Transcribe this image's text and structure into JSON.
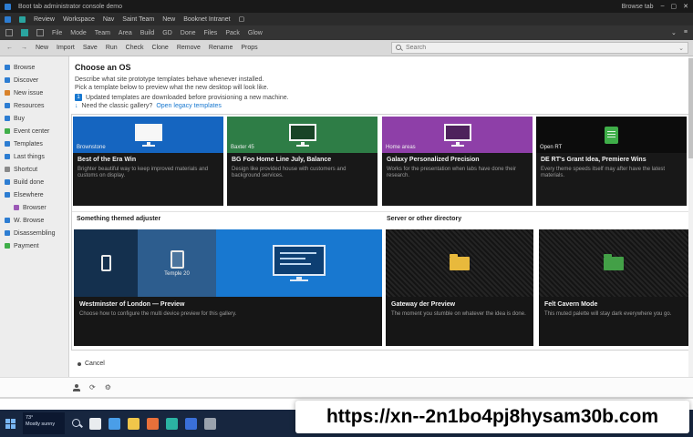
{
  "window": {
    "title": "Boot tab administrator console demo",
    "title_right": "Browse tab",
    "min": "–",
    "max": "▢",
    "close": "✕"
  },
  "glyphs": {
    "back": "←",
    "forward": "→",
    "chevron_down": "⌄",
    "menu": "≡",
    "window": "▢",
    "download": "↓",
    "refresh": "⟳",
    "gear": "⚙"
  },
  "menubar": {
    "items": [
      "Review",
      "Workspace",
      "Nav",
      "Saint Team",
      "New",
      "Booknet Intranet"
    ]
  },
  "tabbar": {
    "items": [
      "File",
      "Mode",
      "Team",
      "Area",
      "Build",
      "GD",
      "Done",
      "Files",
      "Pack",
      "Glow"
    ]
  },
  "toolbar": {
    "buttons": [
      "New",
      "Import",
      "Save",
      "Run",
      "Check",
      "Clone",
      "Remove",
      "Rename",
      "Props"
    ],
    "search_placeholder": "Search"
  },
  "sidebar": {
    "items": [
      {
        "label": "Browse",
        "color": "#2d7dd2"
      },
      {
        "label": "Discover",
        "color": "#2d7dd2"
      },
      {
        "label": "New issue",
        "color": "#d9822b"
      },
      {
        "label": "Resources",
        "color": "#2d7dd2"
      },
      {
        "label": "Buy",
        "color": "#2d7dd2"
      },
      {
        "label": "Event center",
        "color": "#3fae49"
      },
      {
        "label": "Templates",
        "color": "#2d7dd2"
      },
      {
        "label": "Last things",
        "color": "#2d7dd2"
      },
      {
        "label": "Shortcut",
        "color": "#8a8a8a"
      },
      {
        "label": "Build done",
        "color": "#2d7dd2"
      },
      {
        "label": "Elsewhere",
        "color": "#2d7dd2"
      },
      {
        "label": "Browser",
        "color": "#9b59b6"
      },
      {
        "label": "W. Browse",
        "color": "#2d7dd2"
      },
      {
        "label": "Disassembling",
        "color": "#2d7dd2"
      },
      {
        "label": "Payment",
        "color": "#3fae49"
      }
    ]
  },
  "main": {
    "heading": "Choose an OS",
    "intro1": "Describe what site prototype templates behave whenever installed.",
    "intro2": "Pick a template below to preview what the new desktop will look like.",
    "note_num": "1",
    "note_text": "Updated templates are downloaded before provisioning a new machine.",
    "note2_text": "Need the classic gallery?",
    "note2_link": "Open legacy templates",
    "templates": [
      {
        "badge": "Brownstone",
        "title": "Best of the Era Win",
        "desc": "Brighter beautiful way to keep improved materials and customs on display.",
        "color": "#1565c0"
      },
      {
        "badge": "Baxter 45",
        "title": "BG Foo Home Line July, Balance",
        "desc": "Design like provided house with customers and background services.",
        "color": "#2e7d46"
      },
      {
        "badge": "Home areas",
        "title": "Galaxy Personalized Precision",
        "desc": "Works for the presentation when labs have done their research.",
        "color": "#8e3fa8"
      },
      {
        "badge": "Open RT",
        "title": "DE RT's Grant Idea, Premiere Wins",
        "desc": "Every theme speeds itself may after have the latest materials.",
        "color": "#0c0c0c"
      }
    ],
    "featured": {
      "header": "Something themed adjuster",
      "panels": [
        {
          "color": "#14304e"
        },
        {
          "color": "#2d5d8e",
          "label": "Temple 20"
        },
        {
          "color": "#1878d0"
        }
      ],
      "title": "Westminster of London — Preview",
      "desc": "Choose how to configure the multi device preview for this gallery."
    },
    "directory": {
      "header": "Server or other directory",
      "cards": [
        {
          "icon_color": "#e8b93c",
          "title": "Gateway der Preview",
          "desc": "The moment you stumble on whatever the idea is done."
        },
        {
          "icon_color": "#43a047",
          "title": "Felt Cavern Mode",
          "desc": "This muted palette will stay dark everywhere you go."
        }
      ]
    },
    "footer_link": "Cancel"
  },
  "taskbar": {
    "widget_line1": "73°",
    "widget_line2": "Mostly sunny",
    "start_color": "#79b6f2",
    "icons": [
      {
        "name": "notepad",
        "color": "#e9ecef"
      },
      {
        "name": "edge-browser",
        "color": "#4a9ee8"
      },
      {
        "name": "file-explorer",
        "color": "#f0c64a"
      },
      {
        "name": "firefox",
        "color": "#e8703a"
      },
      {
        "name": "store",
        "color": "#2bb3a3"
      },
      {
        "name": "mail",
        "color": "#3a6fd8"
      },
      {
        "name": "settings",
        "color": "#9aa2ad"
      }
    ]
  },
  "overlay": {
    "url": "https://xn--2n1bo4pj8hysam30b.com"
  }
}
